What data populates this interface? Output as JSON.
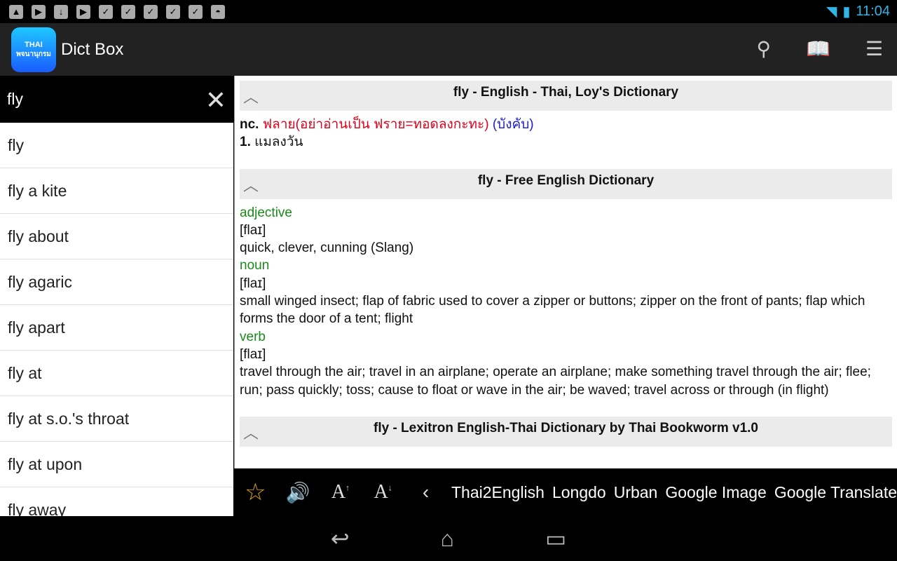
{
  "status": {
    "icons": [
      "image-icon",
      "youtube-icon",
      "download-icon",
      "play-store-icon",
      "store-check-icon",
      "store-check-icon",
      "store-check-icon",
      "store-check-icon",
      "store-check-icon",
      "android-icon"
    ],
    "time": "11:04"
  },
  "appbar": {
    "logo_text_top": "THAI",
    "logo_text_bottom": "พจนานุกรม",
    "title": "Dict Box"
  },
  "search": {
    "value": "fly"
  },
  "list": [
    "fly",
    "fly a kite",
    "fly about",
    "fly agaric",
    "fly apart",
    "fly at",
    "fly at s.o.'s throat",
    "fly at upon",
    "fly away"
  ],
  "sections": [
    {
      "title": "fly - English - Thai, Loy's Dictionary",
      "pos": "nc.",
      "thai_red": "ฟลาย(อย่าอ่านเป็น ฟราย=ทอดลงกะทะ)",
      "thai_blue": "(บังคับ)",
      "num": "1.",
      "meaning": "แมลงวัน"
    },
    {
      "title": "fly - Free English Dictionary",
      "entries": [
        {
          "pos": "adjective",
          "pron": "[flaɪ]",
          "def": "quick, clever, cunning (Slang)"
        },
        {
          "pos": "noun",
          "pron": "[flaɪ]",
          "def": "small winged insect; flap of fabric used to cover a zipper or buttons; zipper on the front of pants; flap which forms the door of a tent; flight"
        },
        {
          "pos": "verb",
          "pron": "[flaɪ]",
          "def": "travel through the air; travel in an airplane; operate an airplane; make something travel through the air; flee; run; pass quickly; toss; cause to float or wave in the air; be waved; travel across or through (in flight)"
        }
      ]
    },
    {
      "title": "fly - Lexitron English-Thai Dictionary by Thai Bookworm v1.0"
    }
  ],
  "toolbar": {
    "links": [
      "Thai2English",
      "Longdo",
      "Urban",
      "Google Image",
      "Google Translate"
    ]
  }
}
